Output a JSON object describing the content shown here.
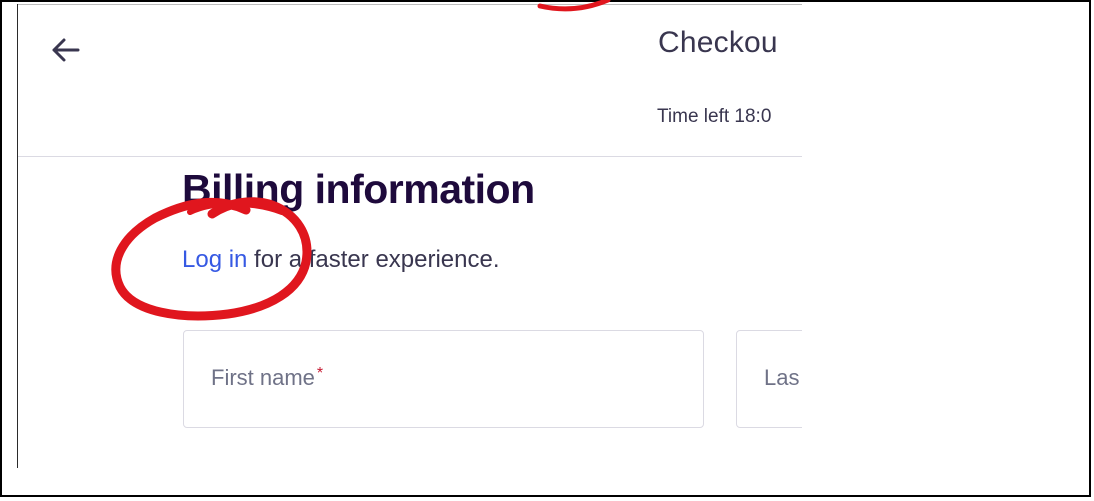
{
  "header": {
    "title": "Checkou",
    "time_left": "Time left 18:0"
  },
  "billing": {
    "heading": "Billing information",
    "login_link": "Log in",
    "login_suffix": " for a faster experience."
  },
  "form": {
    "first_name_label": "First name",
    "required_mark": "*",
    "last_name_label": "Las"
  },
  "colors": {
    "link": "#3659e3",
    "heading": "#1e0a3c",
    "required": "#c5162e",
    "annotation": "#e0161e"
  },
  "icons": {
    "back": "arrow-left-icon"
  }
}
